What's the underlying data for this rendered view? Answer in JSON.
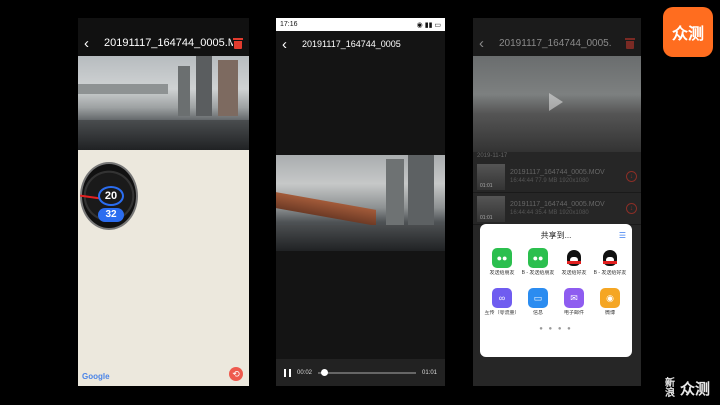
{
  "phone1": {
    "title": "20191117_164744_0005.M",
    "gauge_speed": "20",
    "gauge_limit": "32",
    "map_brand": "Google"
  },
  "phone2": {
    "status_time": "17:16",
    "title": "20191117_164744_0005",
    "time_current": "00:02",
    "time_total": "01:01",
    "progress": 0.03
  },
  "phone3": {
    "title": "20191117_164744_0005.",
    "date_header": "2019-11-17",
    "files": [
      {
        "name": "20191117_164744_0005.MOV",
        "time": "16:44:44",
        "size": "77.9 MB",
        "res": "1920x1080",
        "dur": "01:01"
      },
      {
        "name": "20191117_164744_0005.MOV",
        "time": "16:44:44",
        "size": "35.4 MB",
        "res": "1920x1080",
        "dur": "01:01"
      }
    ],
    "share": {
      "title": "共享到...",
      "items": [
        {
          "label": "发送给朋友",
          "icon": "wechat-icon",
          "color": "#2bbf4e"
        },
        {
          "label": "B - 发送给朋友",
          "icon": "wechat-icon",
          "color": "#2bbf4e"
        },
        {
          "label": "发送给好友",
          "icon": "qq-icon",
          "color": "#ffffff"
        },
        {
          "label": "B - 发送给好友",
          "icon": "qq-icon",
          "color": "#ffffff"
        },
        {
          "label": "互传（零流量）",
          "icon": "transfer-icon",
          "color": "#6f5cf0"
        },
        {
          "label": "信息",
          "icon": "message-icon",
          "color": "#2b8cf0"
        },
        {
          "label": "电子邮件",
          "icon": "mail-icon",
          "color": "#8e5cf0"
        },
        {
          "label": "微博",
          "icon": "weibo-icon",
          "color": "#f5a623"
        }
      ],
      "pager": "● ● ● ●"
    }
  },
  "branding": {
    "logo_text": "众测",
    "watermark_small": "新浪",
    "watermark_big": "众测"
  }
}
